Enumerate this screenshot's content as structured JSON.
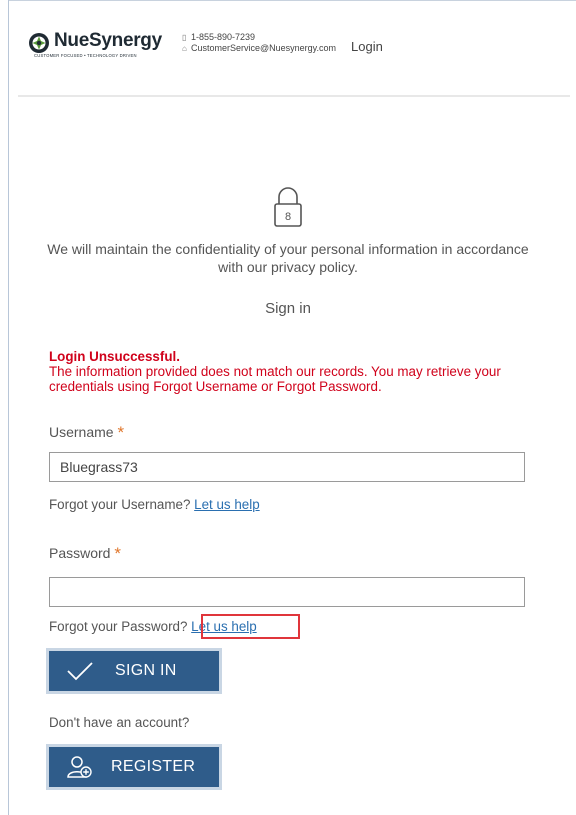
{
  "header": {
    "logo_text": "NueSynergy",
    "logo_tagline": "CUSTOMER FOCUSED • TECHNOLOGY DRIVEN",
    "phone": "1-855-890-7239",
    "email": "CustomerService@Nuesynergy.com",
    "login_link": "Login"
  },
  "main": {
    "privacy_text": "We will maintain the confidentiality of your personal information in accordance with our privacy policy.",
    "title": "Sign in",
    "error_heading": "Login Unsuccessful.",
    "error_message": "The information provided does not match our records. You may retrieve your credentials using Forgot Username or Forgot Password.",
    "username_label": "Username",
    "required_marker": "*",
    "username_value": "Bluegrass73",
    "forgot_username_text": "Forgot your Username?",
    "forgot_username_link": "Let us help",
    "password_label": "Password",
    "password_value": "",
    "forgot_password_text": "Forgot your Password?",
    "forgot_password_link": "Let us help",
    "signin_button": "SIGN IN",
    "no_account_text": "Don't have an account?",
    "register_button": "REGISTER"
  },
  "colors": {
    "brand_button": "#2f5c8a",
    "error": "#d0021b",
    "required": "#e0762b",
    "link": "#2a6fb0",
    "highlight_box": "#e0353b"
  },
  "icons": [
    "logo-mark-icon",
    "phone-icon",
    "home-icon",
    "lock-icon",
    "checkmark-icon",
    "add-user-icon"
  ]
}
